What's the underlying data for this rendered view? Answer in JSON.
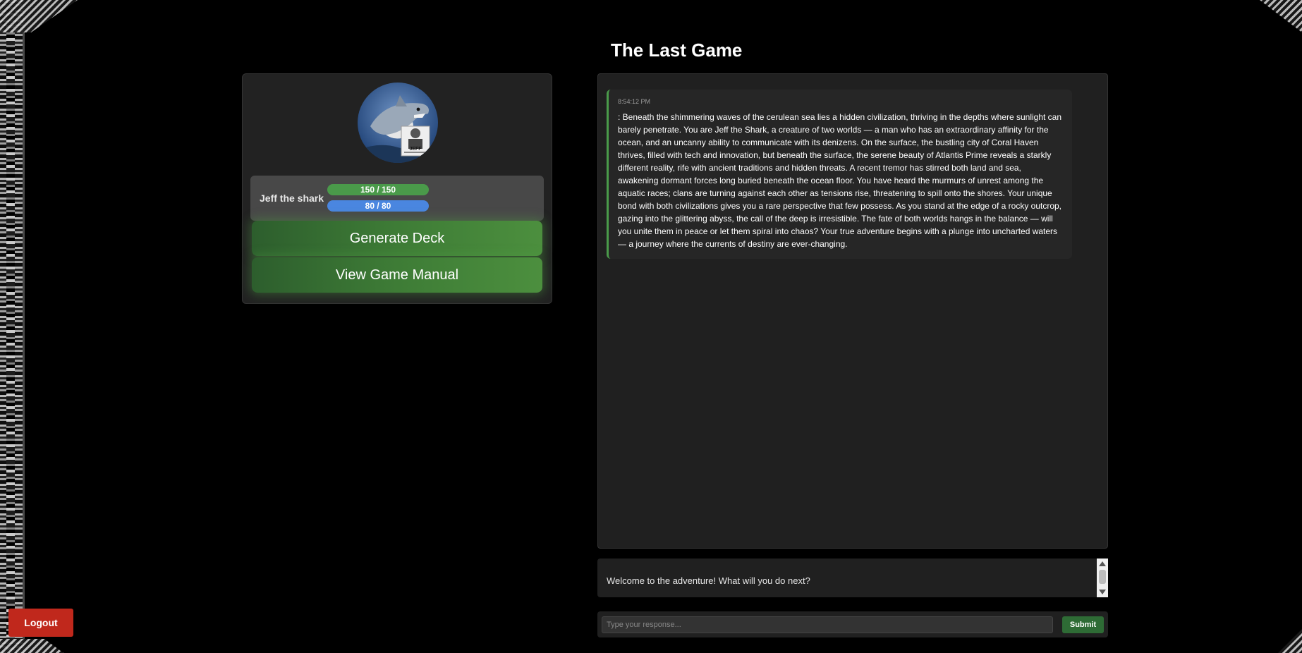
{
  "page": {
    "title": "The Last Game"
  },
  "character": {
    "name": "Jeff the shark",
    "hp_text": "150 / 150",
    "hp_fraction": 1.0,
    "mp_text": "80 / 80",
    "mp_fraction": 1.0,
    "avatar_badge_text": "JEFF"
  },
  "actions": {
    "generate_deck_label": "Generate Deck",
    "view_manual_label": "View Game Manual",
    "logout_label": "Logout"
  },
  "story": {
    "messages": [
      {
        "time": "8:54:12 PM",
        "text": ": Beneath the shimmering waves of the cerulean sea lies a hidden civilization, thriving in the depths where sunlight can barely penetrate. You are Jeff the Shark, a creature of two worlds — a man who has an extraordinary affinity for the ocean, and an uncanny ability to communicate with its denizens. On the surface, the bustling city of Coral Haven thrives, filled with tech and innovation, but beneath the surface, the serene beauty of Atlantis Prime reveals a starkly different reality, rife with ancient traditions and hidden threats. A recent tremor has stirred both land and sea, awakening dormant forces long buried beneath the ocean floor. You have heard the murmurs of unrest among the aquatic races; clans are turning against each other as tensions rise, threatening to spill onto the shores. Your unique bond with both civilizations gives you a rare perspective that few possess. As you stand at the edge of a rocky outcrop, gazing into the glittering abyss, the call of the deep is irresistible. The fate of both worlds hangs in the balance — will you unite them in peace or let them spiral into chaos? Your true adventure begins with a plunge into uncharted waters — a journey where the currents of destiny are ever-changing."
      }
    ]
  },
  "prompt": {
    "welcome_text": "Welcome to the adventure! What will you do next?"
  },
  "input": {
    "placeholder": "Type your response...",
    "value": "",
    "submit_label": "Submit"
  },
  "colors": {
    "accent_green": "#3e7c36",
    "hp_bar": "#4a9a4a",
    "mp_bar": "#4a86e0",
    "logout_red": "#c0281c"
  }
}
